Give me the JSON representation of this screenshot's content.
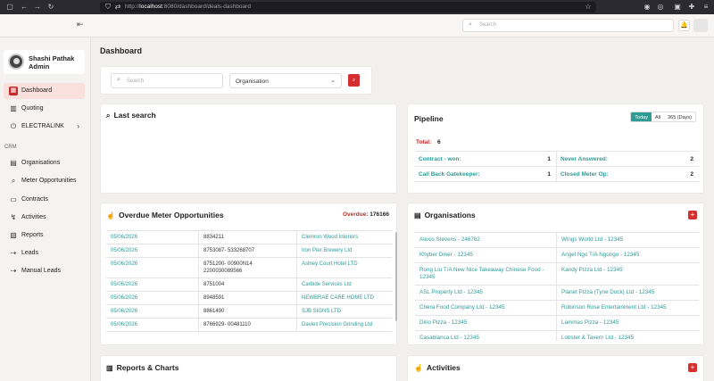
{
  "browser": {
    "url_prefix": "http://",
    "url_host": "localhost",
    "url_rest": ":8080/dashboard/deals-dashboard"
  },
  "topbar": {
    "search_placeholder": "Search"
  },
  "sidebar": {
    "user_name": "Shashi Pathak",
    "user_role": "Admin",
    "section_crm": "CRM",
    "items": [
      {
        "label": "Dashboard",
        "icon": "dashboard-icon"
      },
      {
        "label": "Quoting",
        "icon": "chart-icon"
      },
      {
        "label": "ELECTRALINK",
        "icon": "plug-icon"
      },
      {
        "label": "Organisations",
        "icon": "building-icon"
      },
      {
        "label": "Meter Opportunities",
        "icon": "search-icon"
      },
      {
        "label": "Contracts",
        "icon": "document-icon"
      },
      {
        "label": "Activities",
        "icon": "activity-icon"
      },
      {
        "label": "Reports",
        "icon": "report-icon"
      },
      {
        "label": "Leads",
        "icon": "leads-icon"
      },
      {
        "label": "Manual Leads",
        "icon": "manual-leads-icon"
      }
    ]
  },
  "page": {
    "title": "Dashboard"
  },
  "search": {
    "placeholder": "Search",
    "organisation_label": "Organisation"
  },
  "last_search": {
    "title": "Last search"
  },
  "pipeline": {
    "title": "Pipeline",
    "tabs": [
      "Today",
      "All",
      "365 (Days)"
    ],
    "active_tab": "Today",
    "total_label": "Total:",
    "total_value": "6",
    "rows": [
      [
        {
          "label": "Contract - won:",
          "value": "1"
        },
        {
          "label": "Never Answered:",
          "value": "2"
        }
      ],
      [
        {
          "label": "Call Back Gatekeeper:",
          "value": "1"
        },
        {
          "label": "Closed Meter Op:",
          "value": "2"
        }
      ]
    ]
  },
  "overdue": {
    "title": "Overdue Meter Opportunities",
    "total_label": "Overdue:",
    "total_value": "176166",
    "rows": [
      {
        "date": "05/06/2026",
        "meter": "8834211",
        "company": "Clemron Wood Interiors"
      },
      {
        "date": "05/06/2026",
        "meter": "8753087- 533268707",
        "company": "Iron Pier Brewery Ltd"
      },
      {
        "date": "05/06/2026",
        "meter": "8751200- 00900N14 2200030089566",
        "company": "Ashley Court Hotel LTD"
      },
      {
        "date": "05/06/2026",
        "meter": "8751004",
        "company": "Carbide Services Ltd"
      },
      {
        "date": "05/06/2026",
        "meter": "8948591",
        "company": "NEWBRAE CARE HOME LTD"
      },
      {
        "date": "05/06/2026",
        "meter": "8861490",
        "company": "SJB SIGNS LTD"
      },
      {
        "date": "05/06/2026",
        "meter": "8766929- 00481110",
        "company": "Davies Precision Grinding Ltd"
      }
    ]
  },
  "organisations": {
    "title": "Organisations",
    "add_label": "+",
    "rows": [
      [
        "Alexis Stevens - 246762",
        "Wings World Ltd - 12345"
      ],
      [
        "Khyber Diner - 12345",
        "Angel Ngo T/A Ngongo - 12345"
      ],
      [
        "Rong Liu T/A New Nice Takeaway Chinese Food - 12345",
        "Kandy Pizza Ltd - 12345"
      ],
      [
        "ASL Property Ltd - 12345",
        "Planet Pizza (Tyne Dock) Ltd - 12345"
      ],
      [
        "Chera Food Company Ltd - 12345",
        "Robinson Rose Entertainment Ltd - 12345"
      ],
      [
        "Dino Pizza - 12345",
        "Lammas Pizza - 12345"
      ],
      [
        "Casablanca Ltd - 12345",
        "Lobster & Tavern Ltd - 12345"
      ]
    ]
  },
  "reports": {
    "title": "Reports & Charts"
  },
  "activities": {
    "title": "Activities",
    "add_label": "+"
  }
}
